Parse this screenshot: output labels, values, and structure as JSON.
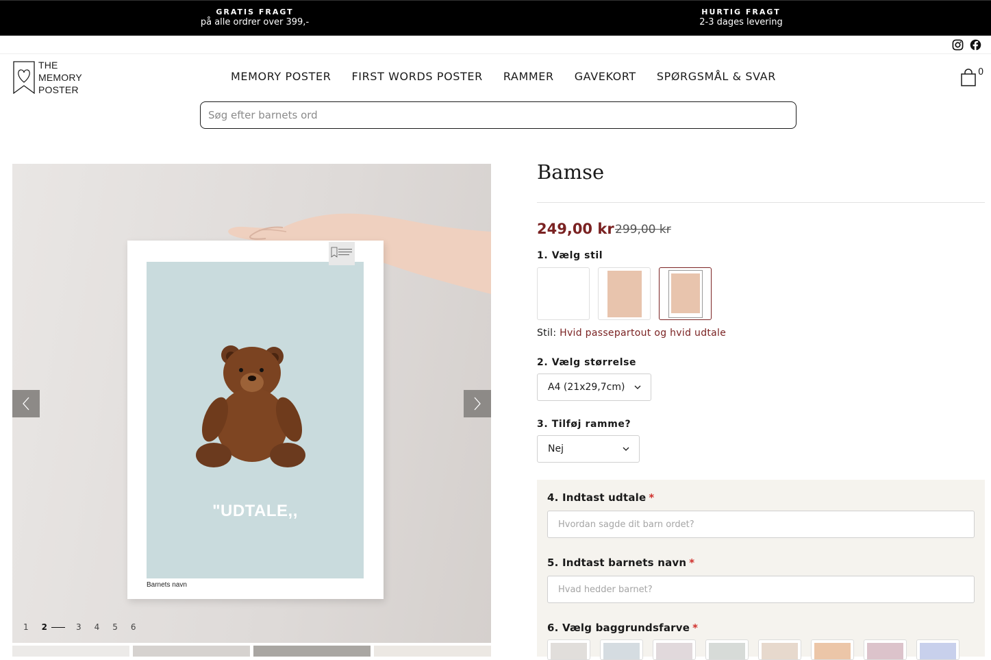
{
  "announcement": [
    {
      "title": "GRATIS FRAGT",
      "sub": "på alle ordrer over 399,-"
    },
    {
      "title": "HURTIG FRAGT",
      "sub": "2-3 dages levering"
    }
  ],
  "social": {
    "instagram": "instagram-icon",
    "facebook": "facebook-icon"
  },
  "logo": {
    "line1": "THE",
    "line2": "MEMORY",
    "line3": "POSTER"
  },
  "nav": [
    "MEMORY POSTER",
    "FIRST WORDS POSTER",
    "RAMMER",
    "GAVEKORT",
    "SPØRGSMÅL & SVAR"
  ],
  "cart": {
    "count": "0"
  },
  "search": {
    "placeholder": "Søg efter barnets ord"
  },
  "gallery": {
    "poster_word": "\"UDTALE,,",
    "poster_name": "Barnets navn",
    "poster_logo": "THE MEMORY POSTER",
    "pages": [
      "1",
      "2",
      "3",
      "4",
      "5",
      "6"
    ],
    "active_page": "2"
  },
  "product": {
    "title": "Bamse",
    "price": "249,00 kr",
    "price_old": "299,00 kr",
    "step1_label": "1. Vælg stil",
    "style_prefix": "Stil:",
    "style_value": "Hvid passepartout og hvid udtale",
    "step2_label": "2. Vælg størrelse",
    "size_value": "A4 (21x29,7cm)",
    "step3_label": "3. Tilføj ramme?",
    "frame_value": "Nej",
    "step4_label": "4. Indtast udtale",
    "step4_placeholder": "Hvordan sagde dit barn ordet?",
    "step5_label": "5. Indtast barnets navn",
    "step5_placeholder": "Hvad hedder barnet?",
    "step6_label": "6. Vælg baggrundsfarve",
    "required_mark": "*",
    "swatches": [
      "#e1dedb",
      "#d5dce1",
      "#e1d9dc",
      "#d7dbd8",
      "#e7d9cd",
      "#ecc6a8",
      "#dcc3cb",
      "#c8d0ec"
    ]
  },
  "colors": {
    "accent": "#7a2222",
    "required": "#d0312d"
  }
}
